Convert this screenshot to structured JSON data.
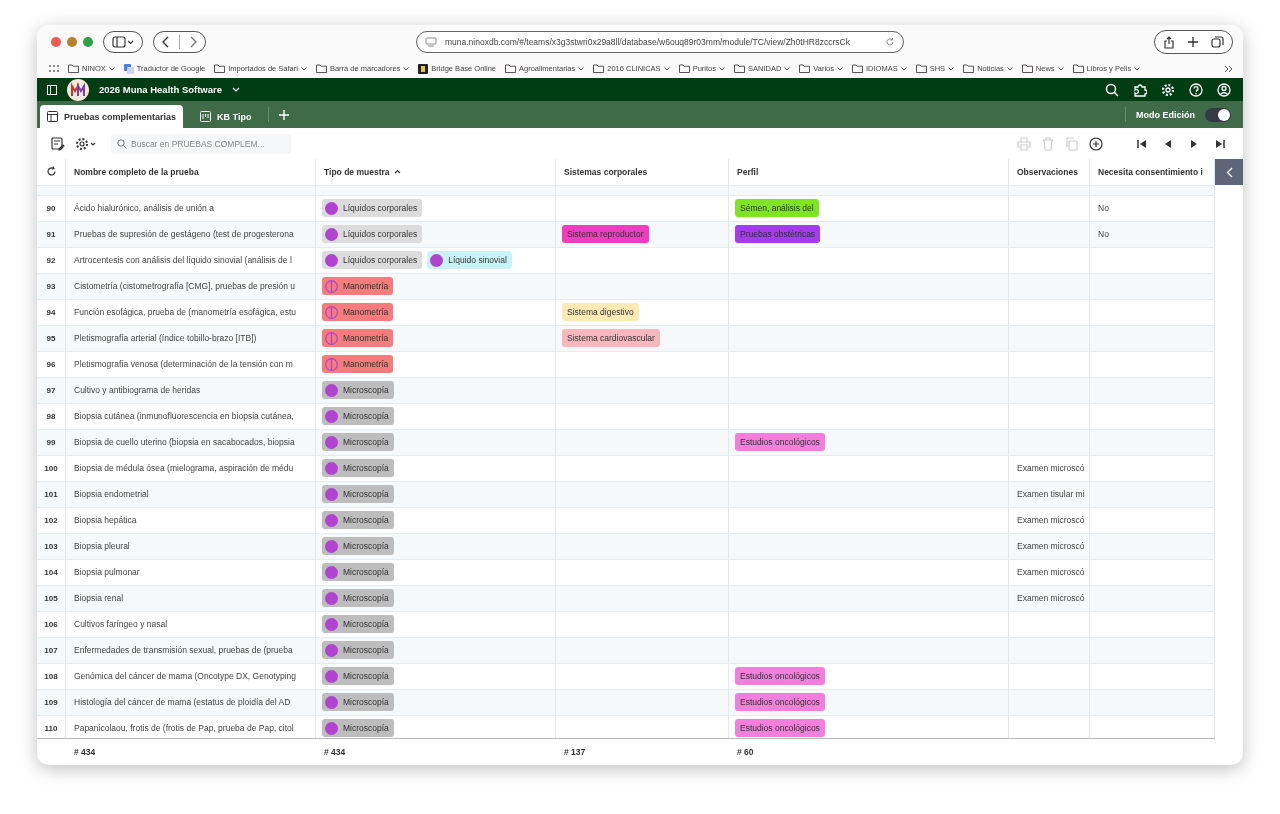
{
  "browser": {
    "url": "muna.ninoxdb.com/#/teams/x3g3stwri0x29a8ll/database/w6ouq89r03mm/module/TC/view/Zh0tHR8zccrsCk",
    "bookmarks": [
      {
        "label": "NINOX",
        "kind": "folder",
        "menu": true
      },
      {
        "label": "Traductor de Google",
        "kind": "translate",
        "menu": false
      },
      {
        "label": "Importados de Safari",
        "kind": "folder",
        "menu": true
      },
      {
        "label": "Barra de marcadores",
        "kind": "folder",
        "menu": true
      },
      {
        "label": "Bridge Base Online",
        "kind": "site",
        "menu": false
      },
      {
        "label": "Agroalimentarias",
        "kind": "folder",
        "menu": true
      },
      {
        "label": "2016 CLINICAS",
        "kind": "folder",
        "menu": true
      },
      {
        "label": "Puritos",
        "kind": "folder",
        "menu": true
      },
      {
        "label": "SANIDAD",
        "kind": "folder",
        "menu": true
      },
      {
        "label": "Varios",
        "kind": "folder",
        "menu": true
      },
      {
        "label": "IDIOMAS",
        "kind": "folder",
        "menu": true
      },
      {
        "label": "SHS",
        "kind": "folder",
        "menu": true
      },
      {
        "label": "Noticias",
        "kind": "folder",
        "menu": true
      },
      {
        "label": "News",
        "kind": "folder",
        "menu": true
      },
      {
        "label": "Libros y Pelis",
        "kind": "folder",
        "menu": true
      }
    ]
  },
  "app": {
    "title": "2026 Muna Health Software"
  },
  "tabs": [
    {
      "label": "Pruebas complementarias",
      "selected": true,
      "kind": "table"
    },
    {
      "label": "KB Tipo",
      "selected": false,
      "kind": "kanban"
    }
  ],
  "edit_mode": {
    "label": "Modo Edición",
    "on": true
  },
  "search": {
    "placeholder": "Buscar en PRUEBAS COMPLEM..."
  },
  "table": {
    "columns": [
      {
        "label": "Nombre completo de la prueba"
      },
      {
        "label": "Tipo de muestra",
        "sorted": true
      },
      {
        "label": "Sistemas corporales"
      },
      {
        "label": "Perfil"
      },
      {
        "label": "Observaciones"
      },
      {
        "label": "Necesita consentimiento i"
      }
    ],
    "rows": [
      {
        "num": "90",
        "name": "Ácido hialurónico, análisis de unión a",
        "tipo": [
          {
            "label": "Líquidos corporales",
            "kind": "dot",
            "color": "#dcdcdc"
          }
        ],
        "perfil": [
          {
            "label": "Sémen, análisis del",
            "color": "#7ee51e"
          }
        ],
        "consent": "No"
      },
      {
        "num": "91",
        "name": "Pruebas de supresión de gestágeno (test de progesterona",
        "tipo": [
          {
            "label": "Líquidos corporales",
            "kind": "dot",
            "color": "#dcdcdc"
          }
        ],
        "sistemas": [
          {
            "label": "Sistema reproductor",
            "color": "#f03cc0"
          }
        ],
        "perfil": [
          {
            "label": "Pruebas obstétricas",
            "color": "#a33cf0"
          }
        ],
        "consent": "No"
      },
      {
        "num": "92",
        "name": "Artrocentesis con análisis del líquido sinovial (análisis de l",
        "tipo": [
          {
            "label": "Líquidos corporales",
            "kind": "dot",
            "color": "#dcdcdc"
          },
          {
            "label": "Líquido sinovial",
            "kind": "dot",
            "color": "#c8f4f8"
          }
        ]
      },
      {
        "num": "93",
        "name": "Cistometría (cistometrografía [CMG], pruebas de presión u",
        "tipo": [
          {
            "label": "Manometría",
            "kind": "half",
            "color": "#f47c7c"
          }
        ]
      },
      {
        "num": "94",
        "name": "Función esofágica, prueba de (manometría esofágica, estu",
        "tipo": [
          {
            "label": "Manometría",
            "kind": "half",
            "color": "#f47c7c"
          }
        ],
        "sistemas": [
          {
            "label": "Sistema digestivo",
            "color": "#fdeab5"
          }
        ]
      },
      {
        "num": "95",
        "name": "Pletismografía arterial  (índice tobillo-brazo [ITB])",
        "tipo": [
          {
            "label": "Manometría",
            "kind": "half",
            "color": "#f47c7c"
          }
        ],
        "sistemas": [
          {
            "label": "Sistema cardiovascular",
            "color": "#f6b8bc"
          }
        ]
      },
      {
        "num": "96",
        "name": "Pletismografía venosa (determinación de la tensión con m",
        "tipo": [
          {
            "label": "Manometría",
            "kind": "half",
            "color": "#f47c7c"
          }
        ]
      },
      {
        "num": "97",
        "name": "Cultivo y antibiograma de heridas",
        "tipo": [
          {
            "label": "Microscopía",
            "kind": "dot",
            "color": "#bdbdbd"
          }
        ]
      },
      {
        "num": "98",
        "name": "Biopsia cutánea (inmunofluorescencia en biopsia cutánea,",
        "tipo": [
          {
            "label": "Microscopía",
            "kind": "dot",
            "color": "#bdbdbd"
          }
        ]
      },
      {
        "num": "99",
        "name": "Biopsia de cuello uterino (biopsia en sacabocados, biopsia",
        "tipo": [
          {
            "label": "Microscopía",
            "kind": "dot",
            "color": "#bdbdbd"
          }
        ],
        "perfil": [
          {
            "label": "Estudios oncológicos",
            "color": "#f27fdb"
          }
        ]
      },
      {
        "num": "100",
        "name": "Biopsia de médula ósea (mielograma, aspiración de médu",
        "tipo": [
          {
            "label": "Microscopía",
            "kind": "dot",
            "color": "#bdbdbd"
          }
        ],
        "obs": "Examen microscó"
      },
      {
        "num": "101",
        "name": "Biopsia endometrial",
        "tipo": [
          {
            "label": "Microscopía",
            "kind": "dot",
            "color": "#bdbdbd"
          }
        ],
        "obs": "Examen tisular mi"
      },
      {
        "num": "102",
        "name": "Biopsia hepática",
        "tipo": [
          {
            "label": "Microscopía",
            "kind": "dot",
            "color": "#bdbdbd"
          }
        ],
        "obs": "Examen microscó"
      },
      {
        "num": "103",
        "name": "Biopsia pleural",
        "tipo": [
          {
            "label": "Microscopía",
            "kind": "dot",
            "color": "#bdbdbd"
          }
        ],
        "obs": "Examen microscó"
      },
      {
        "num": "104",
        "name": "Biopsia pulmonar",
        "tipo": [
          {
            "label": "Microscopía",
            "kind": "dot",
            "color": "#bdbdbd"
          }
        ],
        "obs": "Examen microscó"
      },
      {
        "num": "105",
        "name": "Biopsia renal",
        "tipo": [
          {
            "label": "Microscopía",
            "kind": "dot",
            "color": "#bdbdbd"
          }
        ],
        "obs": "Examen microscó"
      },
      {
        "num": "106",
        "name": "Cultivos faríngeo y nasal",
        "tipo": [
          {
            "label": "Microscopía",
            "kind": "dot",
            "color": "#bdbdbd"
          }
        ]
      },
      {
        "num": "107",
        "name": "Enfermedades de transmisión sexual, pruebas de  (prueba",
        "tipo": [
          {
            "label": "Microscopía",
            "kind": "dot",
            "color": "#bdbdbd"
          }
        ]
      },
      {
        "num": "108",
        "name": "Genómica del cáncer de mama  (Oncotype DX, Genotyping",
        "tipo": [
          {
            "label": "Microscopía",
            "kind": "dot",
            "color": "#bdbdbd"
          }
        ],
        "perfil": [
          {
            "label": "Estudios oncológicos",
            "color": "#f27fdb"
          }
        ]
      },
      {
        "num": "109",
        "name": "Histología del cáncer de mama  (estatus de ploidía del AD",
        "tipo": [
          {
            "label": "Microscopía",
            "kind": "dot",
            "color": "#bdbdbd"
          }
        ],
        "perfil": [
          {
            "label": "Estudios oncológicos",
            "color": "#f27fdb"
          }
        ]
      },
      {
        "num": "110",
        "name": "Papanicolaou, frotis de  (frotis de Pap, prueba de Pap, citol",
        "tipo": [
          {
            "label": "Microscopía",
            "kind": "dot",
            "color": "#bdbdbd"
          }
        ],
        "perfil": [
          {
            "label": "Estudios oncológicos",
            "color": "#f27fdb"
          }
        ]
      }
    ],
    "footer": [
      "# 434",
      "# 434",
      "# 137",
      "# 60"
    ]
  }
}
